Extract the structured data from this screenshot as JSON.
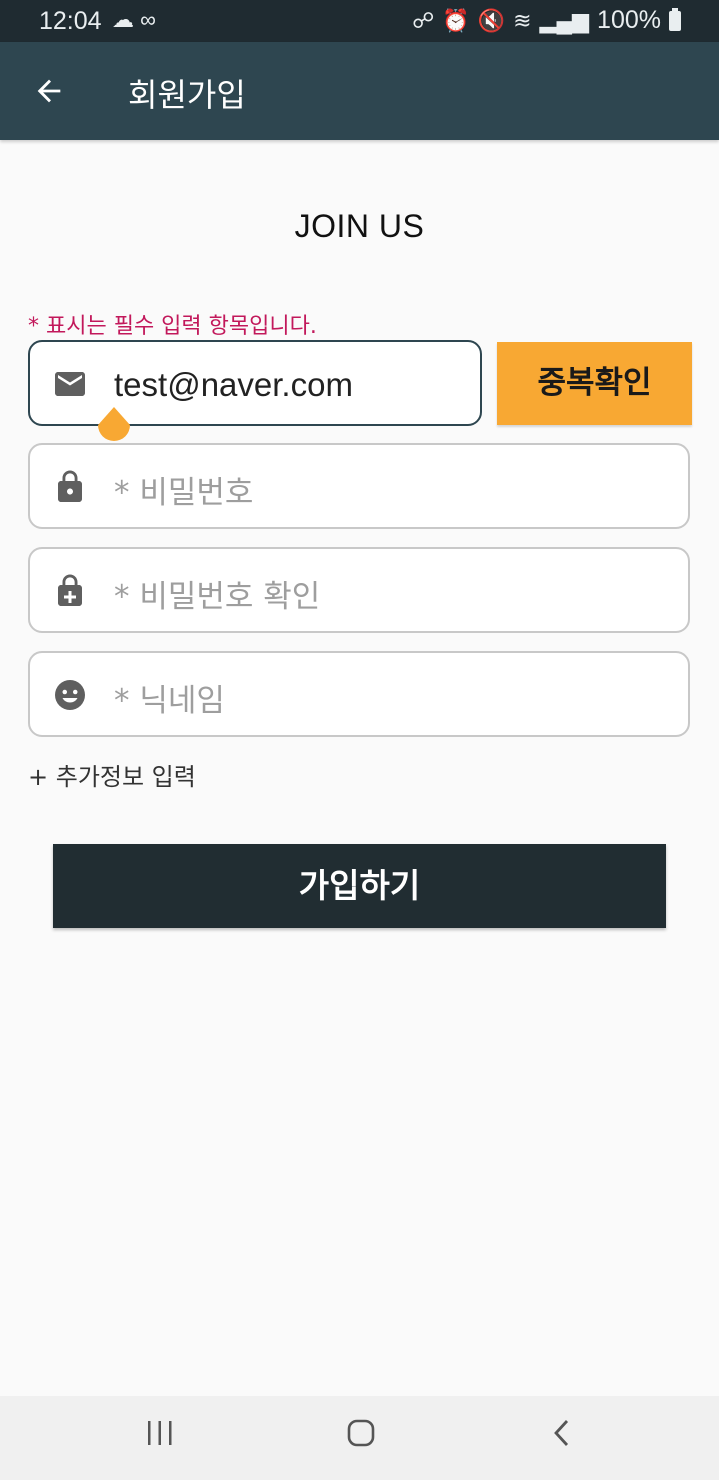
{
  "status_bar": {
    "time": "12:04",
    "battery": "100%",
    "left_icons": "weather-icon, link-icon",
    "right_icons": "key-icon, alarm-icon, mute-icon, wifi-icon, signal-icon, battery-icon"
  },
  "app_bar": {
    "title": "회원가입",
    "back_icon": "arrow-left-icon"
  },
  "form": {
    "heading": "JOIN US",
    "required_note": "* 표시는 필수 입력 항목입니다.",
    "email": {
      "value": "test@naver.com",
      "icon": "email-icon"
    },
    "dup_check_label": "중복확인",
    "password": {
      "placeholder": "* 비밀번호",
      "icon": "lock-icon"
    },
    "password_confirm": {
      "placeholder": "* 비밀번호 확인",
      "icon": "lock-plus-icon"
    },
    "nickname": {
      "placeholder": "* 닉네임",
      "icon": "smiley-icon"
    },
    "extra_info_label": "+ 추가정보 입력",
    "submit_label": "가입하기"
  },
  "colors": {
    "status_bar_bg": "#1f2b31",
    "app_bar_bg": "#2e4650",
    "accent_orange": "#f8a833",
    "required_pink": "#c2185b",
    "submit_bg": "#212d32"
  }
}
